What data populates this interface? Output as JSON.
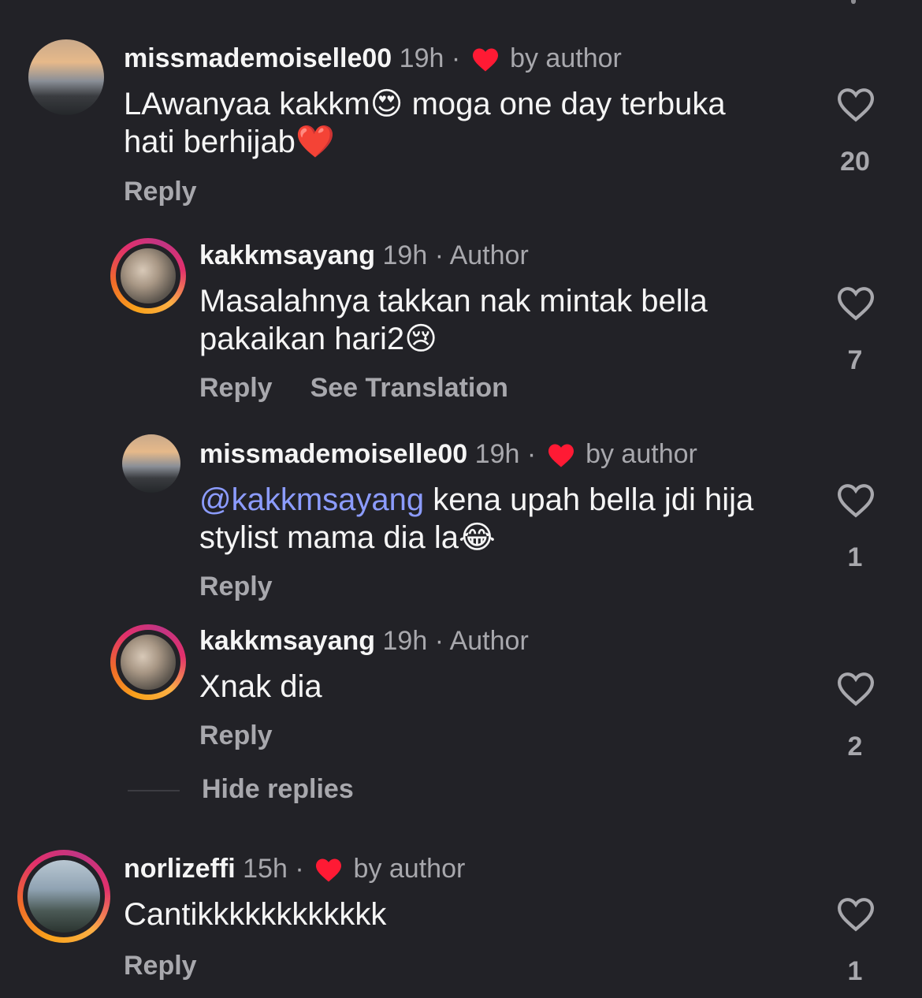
{
  "comments": [
    {
      "username": "missmademoiselle00",
      "time": "19h",
      "badge": "by author",
      "badge_type": "liked-by-author",
      "text": "LAwanyaa kakkm",
      "emoji1": "😍",
      "text_after": " moga one day terbuka",
      "line2": "hati berhijab",
      "emoji2": "❤️",
      "reply_label": "Reply",
      "likes": "20"
    },
    {
      "username": "kakkmsayang",
      "time": "19h",
      "badge": "Author",
      "line1": "Masalahnya takkan nak mintak bella",
      "line2": "pakaikan hari2",
      "emoji": "😢",
      "reply_label": "Reply",
      "translate_label": "See Translation",
      "likes": "7"
    },
    {
      "username": "missmademoiselle00",
      "time": "19h",
      "badge": "by author",
      "mention": "@kakkmsayang",
      "line1_rest": " kena upah bella jdi hija",
      "line2": "stylist mama dia la",
      "emoji": "😂",
      "reply_label": "Reply",
      "likes": "1"
    },
    {
      "username": "kakkmsayang",
      "time": "19h",
      "badge": "Author",
      "line1": "Xnak dia",
      "reply_label": "Reply",
      "likes": "2"
    },
    {
      "username": "norlizeffi",
      "time": "15h",
      "badge": "by author",
      "line1": "Cantikkkkkkkkkkkk",
      "reply_label": "Reply",
      "likes": "1"
    }
  ],
  "hide_replies_label": "Hide replies",
  "colors": {
    "background": "#222227",
    "muted": "#a8a8ad",
    "mention": "#8c9cff",
    "heart_red": "#ff1a34"
  },
  "icons": {
    "like": "heart-outline-icon",
    "author_like": "heart-filled-red-icon"
  }
}
